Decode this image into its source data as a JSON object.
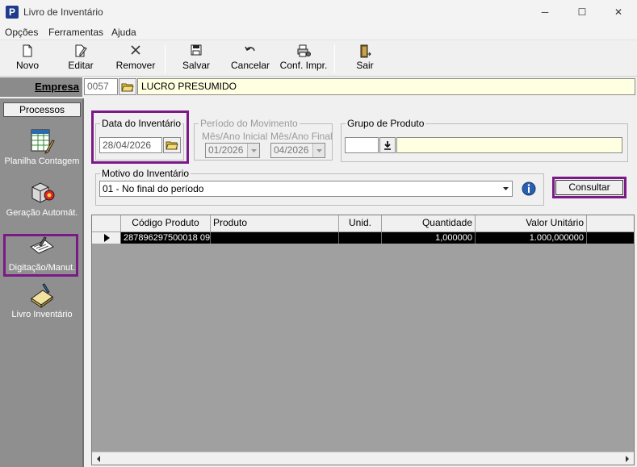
{
  "window": {
    "title": "Livro de Inventário",
    "app_icon_letter": "P",
    "minimize_glyph": "─",
    "maximize_glyph": "☐",
    "close_glyph": "✕"
  },
  "menu": [
    "Opções",
    "Ferramentas",
    "Ajuda"
  ],
  "toolbar": {
    "novo": "Novo",
    "editar": "Editar",
    "remover": "Remover",
    "salvar": "Salvar",
    "cancelar": "Cancelar",
    "conf_impr": "Conf. Impr.",
    "sair": "Sair"
  },
  "empresa": {
    "label": "Empresa",
    "code": "0057",
    "name": "LUCRO PRESUMIDO"
  },
  "processos": {
    "header": "Processos",
    "items": [
      "Planilha Contagem",
      "Geração Automát.",
      "Digitação/Manut.",
      "Livro Inventário"
    ]
  },
  "data_inventario": {
    "legend": "Data do Inventário",
    "value": "28/04/2026"
  },
  "periodo": {
    "legend": "Período do Movimento",
    "inicial_label": "Mês/Ano Inicial",
    "inicial_value": "01/2026",
    "final_label": "Mês/Ano Final",
    "final_value": "04/2026"
  },
  "grupo": {
    "legend": "Grupo de Produto",
    "code": "",
    "name": ""
  },
  "motivo": {
    "legend": "Motivo do Inventário",
    "value": "01 - No final do período"
  },
  "consultar_label": "Consultar",
  "grid": {
    "columns": [
      "Código Produto",
      "Produto",
      "Unid.",
      "Quantidade",
      "Valor Unitário"
    ],
    "rows": [
      {
        "codigo": "287896297500018 09(",
        "produto": "",
        "unid": "",
        "quantidade": "1,000000",
        "valor": "1.000,000000"
      }
    ]
  }
}
